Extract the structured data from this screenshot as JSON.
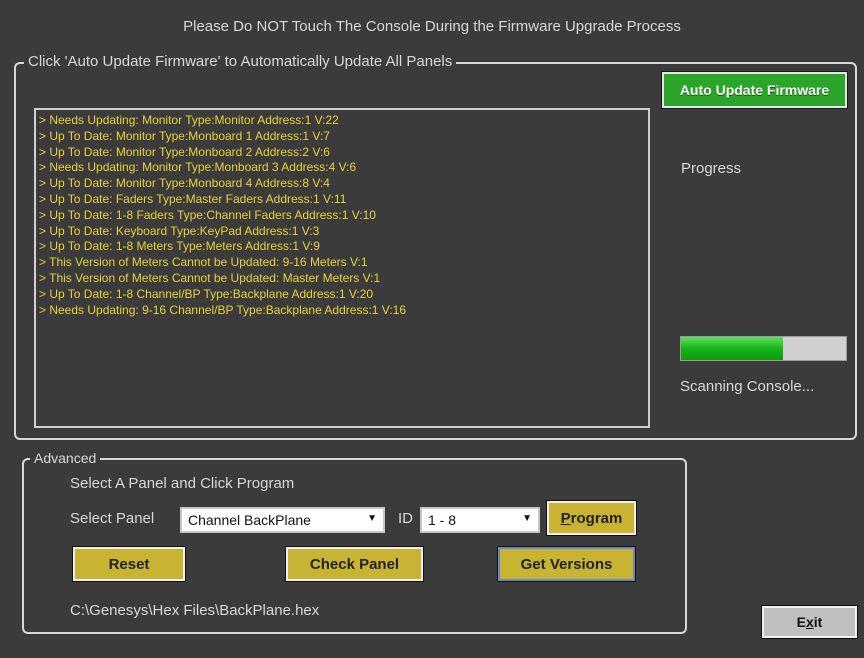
{
  "window": {
    "title": "Please Do NOT Touch The Console During the Firmware Upgrade Process"
  },
  "auto_update": {
    "group_label": "Click 'Auto Update Firmware' to Automatically Update All Panels",
    "button_label": "Auto Update Firmware",
    "progress_label": "Progress",
    "progress_fraction": 0.62,
    "status_text": "Scanning Console...",
    "log": [
      "> Needs Updating:  Monitor Type:Monitor Address:1 V:22",
      "> Up To Date:  Monitor Type:Monboard 1 Address:1 V:7",
      "> Up To Date:  Monitor Type:Monboard 2 Address:2 V:6",
      "> Needs Updating:  Monitor Type:Monboard 3 Address:4 V:6",
      "> Up To Date:  Monitor Type:Monboard 4 Address:8 V:4",
      "> Up To Date:  Faders Type:Master Faders Address:1 V:11",
      "> Up To Date: 1-8 Faders Type:Channel Faders Address:1 V:10",
      "> Up To Date:  Keyboard Type:KeyPad Address:1 V:3",
      "> Up To Date: 1-8 Meters Type:Meters Address:1 V:9",
      "> This Version of Meters Cannot be Updated: 9-16 Meters V:1",
      "> This Version of Meters Cannot be Updated: Master Meters V:1",
      "> Up To Date: 1-8 Channel/BP Type:Backplane Address:1 V:20",
      "> Needs Updating: 9-16 Channel/BP Type:Backplane Address:1 V:16"
    ]
  },
  "advanced": {
    "group_label": "Advanced",
    "hint": "Select A Panel and Click Program",
    "select_panel_label": "Select Panel",
    "select_panel_value": "Channel BackPlane",
    "id_label": "ID",
    "id_value": "1 - 8",
    "program_label_underlined": "P",
    "program_label_rest": "rogram",
    "reset_label": "Reset",
    "check_panel_label": "Check Panel",
    "get_versions_label": "Get Versions",
    "file_path": "C:\\Genesys\\Hex Files\\BackPlane.hex"
  },
  "exit": {
    "label_before": "E",
    "label_underlined": "x",
    "label_after": "it"
  },
  "colors": {
    "background": "#3b3b3b",
    "log_text": "#e8d23a",
    "auto_button": "#2aa52a",
    "action_button": "#c8b432",
    "progress_fill": "#17b517"
  }
}
